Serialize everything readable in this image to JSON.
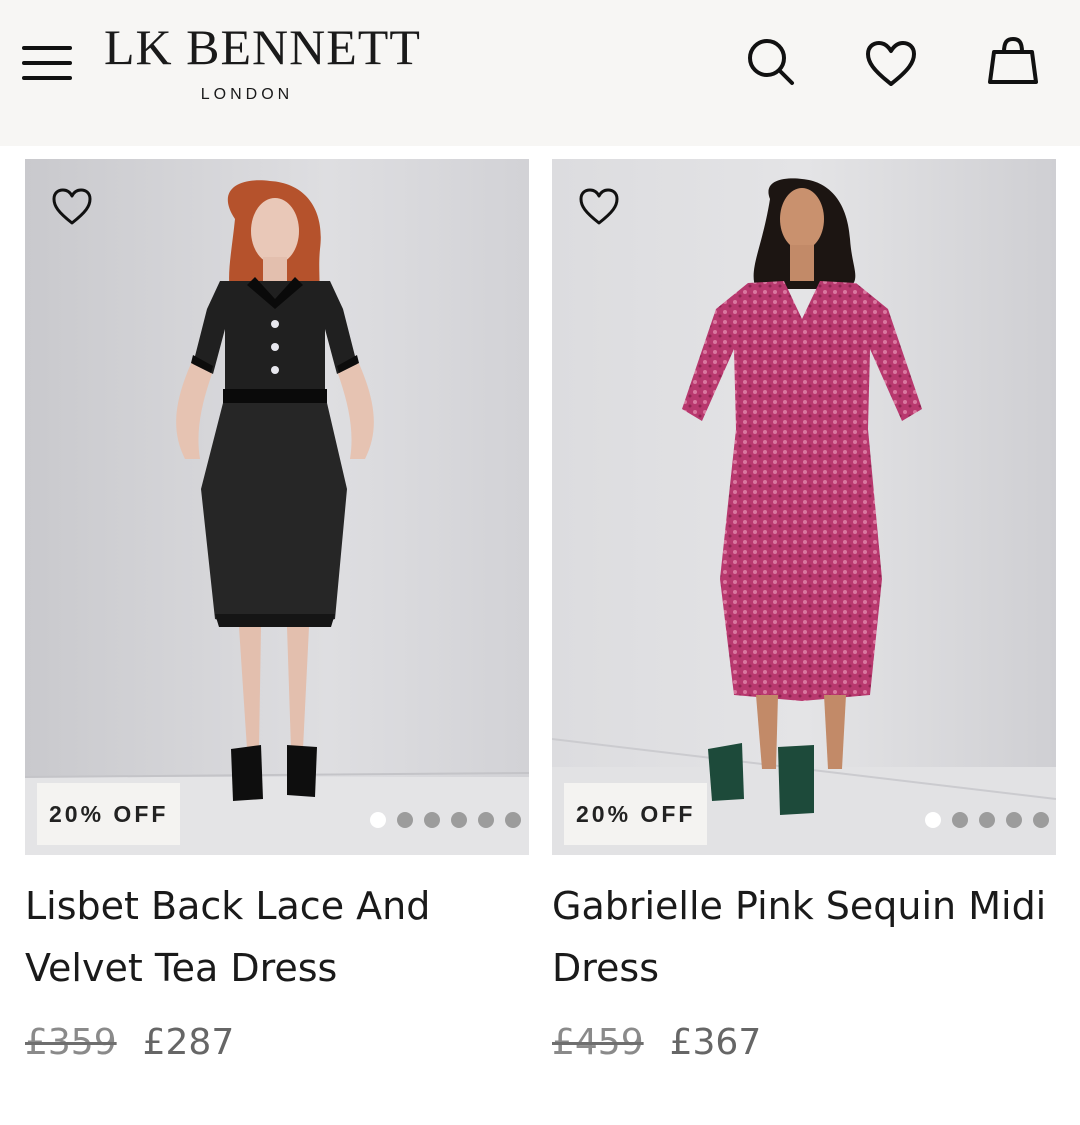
{
  "header": {
    "brand": "LK BENNETT",
    "brand_sub": "LONDON",
    "icons": [
      "menu-icon",
      "search-icon",
      "heart-icon",
      "shopping-bag-icon"
    ]
  },
  "products": [
    {
      "name": "Lisbet Back Lace And Velvet Tea Dress",
      "name_line1": "Lisbet Back Lace And",
      "name_line2": "Velvet Tea Dress",
      "badge": "20% OFF",
      "old_price": "£359",
      "new_price": "£287",
      "carousel": {
        "images": 6,
        "active": 1
      },
      "dress_color": "#1c1c1c"
    },
    {
      "name": "Gabrielle Pink Sequin Midi Dress",
      "name_line1": "Gabrielle Pink Sequin Midi",
      "name_line2": "Dress",
      "badge": "20% OFF",
      "old_price": "£459",
      "new_price": "£367",
      "carousel": {
        "images": 5,
        "active": 1
      },
      "dress_color": "#b8386e"
    }
  ],
  "colors": {
    "header_bg": "#f7f6f4",
    "photo_bg": "#dcdcdf",
    "badge_bg": "#f4f3f1"
  }
}
